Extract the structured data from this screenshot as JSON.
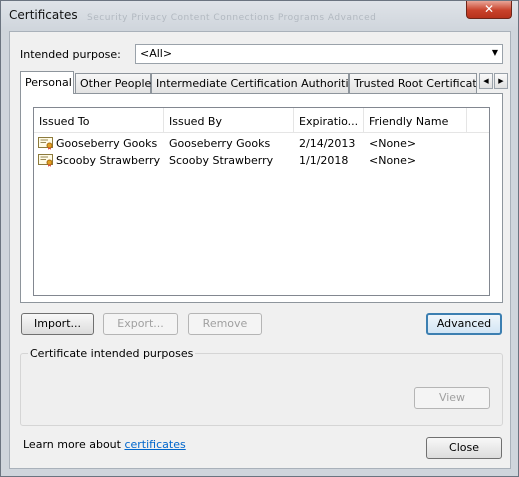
{
  "window": {
    "title": "Certificates",
    "ghost_tabs": "Security   Privacy   Content   Connections   Programs   Advanced",
    "close_glyph": "✕"
  },
  "purpose": {
    "label": "Intended purpose:",
    "value": "<All>"
  },
  "tabs": [
    {
      "label": "Personal",
      "active": true
    },
    {
      "label": "Other People"
    },
    {
      "label": "Intermediate Certification Authorities"
    },
    {
      "label": "Trusted Root Certification"
    }
  ],
  "tab_scroll": {
    "left": "◀",
    "right": "▶"
  },
  "list": {
    "columns": [
      "Issued To",
      "Issued By",
      "Expiratio...",
      "Friendly Name"
    ],
    "rows": [
      {
        "issued_to": "Gooseberry Gooks",
        "issued_by": "Gooseberry Gooks",
        "expiration": "2/14/2013",
        "friendly_name": "<None>"
      },
      {
        "issued_to": "Scooby Strawberry",
        "issued_by": "Scooby Strawberry",
        "expiration": "1/1/2018",
        "friendly_name": "<None>"
      }
    ]
  },
  "buttons": {
    "import": "Import...",
    "export": "Export...",
    "remove": "Remove",
    "advanced": "Advanced",
    "view": "View",
    "close": "Close"
  },
  "purposes_group": {
    "label": "Certificate intended purposes"
  },
  "footer": {
    "learn_prefix": "Learn more about ",
    "learn_link": "certificates"
  },
  "colors": {
    "link": "#0066cc",
    "close_button": "#c8412a",
    "default_button_border": "#3c7fb1"
  }
}
